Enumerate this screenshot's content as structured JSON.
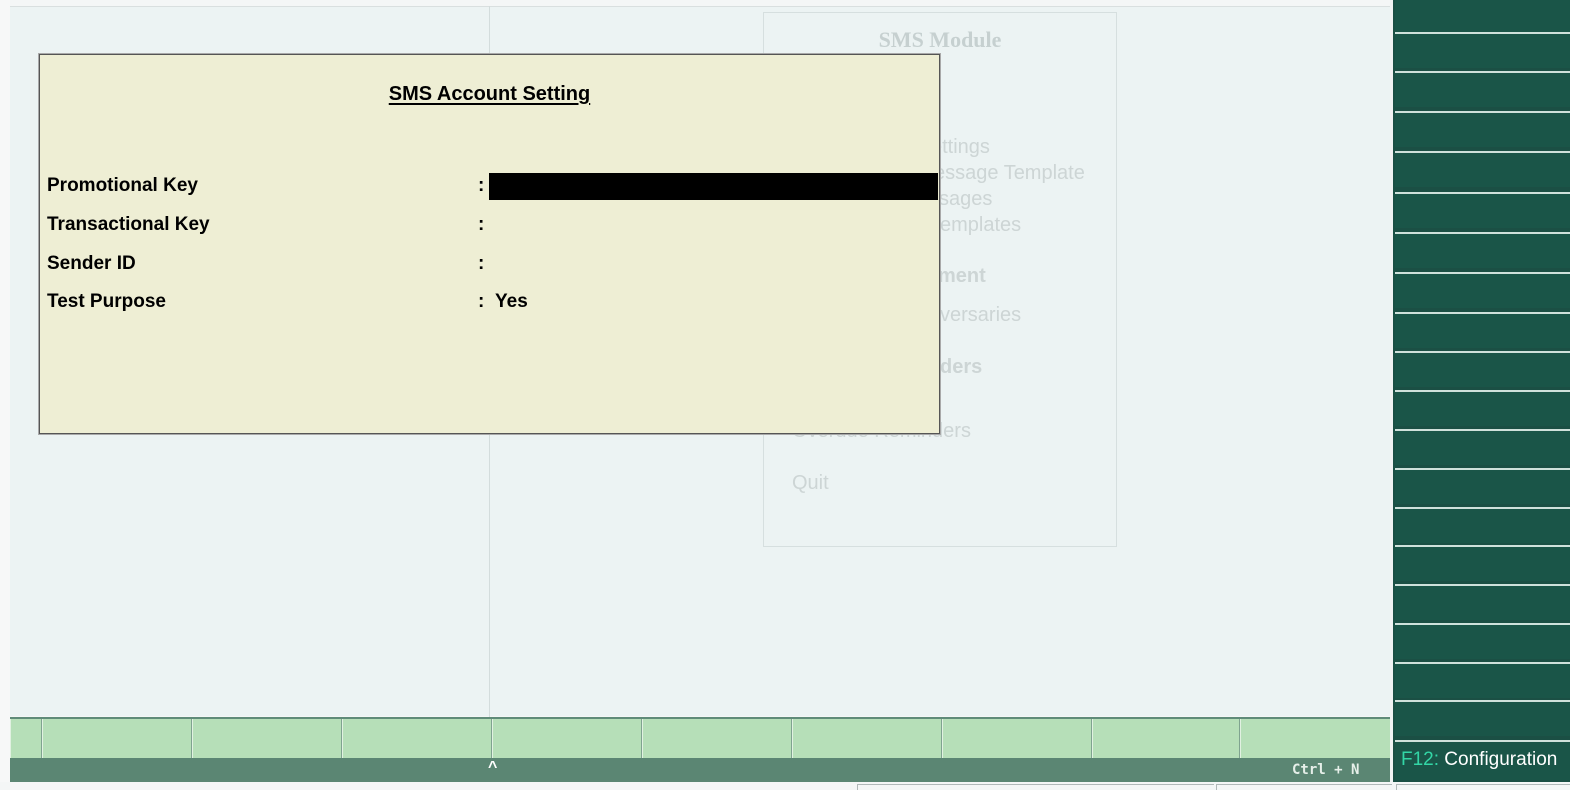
{
  "background_menu": {
    "title": "SMS Module",
    "items": [
      {
        "label": "ettings",
        "heading": false
      },
      {
        "label": "essage Template",
        "heading": false
      },
      {
        "label": "sages",
        "heading": false
      },
      {
        "label": "emplates",
        "heading": false
      },
      {
        "label": "ment",
        "heading": true
      },
      {
        "label": "versaries",
        "heading": false
      },
      {
        "label": "ders",
        "heading": true
      },
      {
        "label": "Overdue Reminders",
        "heading": false
      },
      {
        "label": "Quit",
        "heading": false
      }
    ]
  },
  "dialog": {
    "title": "SMS Account Setting",
    "fields": [
      {
        "label": "Promotional Key",
        "colon": ":",
        "value": ""
      },
      {
        "label": "Transactional Key",
        "colon": ":",
        "value": ""
      },
      {
        "label": "Sender ID",
        "colon": ":",
        "value": ""
      },
      {
        "label": "Test Purpose",
        "colon": ":",
        "value": "Yes"
      }
    ]
  },
  "status_bar": {
    "caret": "^",
    "shortcut": "Ctrl + N"
  },
  "right_panel": {
    "config_key": "F12:",
    "config_label": " Configuration"
  },
  "colors": {
    "dialog_bg": "#eeeed4",
    "fkey_bar": "#b6dfb8",
    "status_bar": "#5b8673",
    "panel_bg": "#1a5548",
    "key_accent": "#33d6a6"
  }
}
